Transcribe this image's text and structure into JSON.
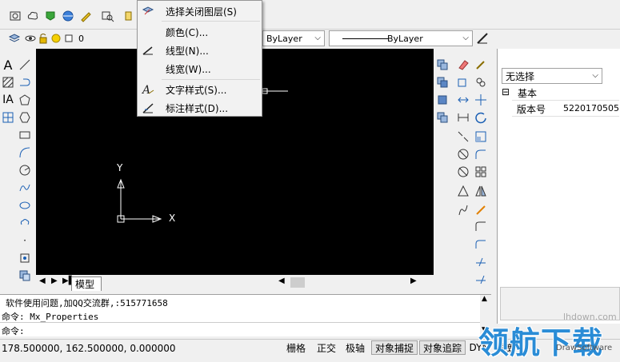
{
  "layer": {
    "current": "0"
  },
  "linetype": {
    "value": "ByLayer"
  },
  "lineweight": {
    "value": "ByLayer"
  },
  "context_menu": {
    "items": [
      {
        "label": "选择关闭图层(S)",
        "icon": "layer-off-icon"
      },
      {
        "label": "颜色(C)...",
        "icon": ""
      },
      {
        "label": "线型(N)...",
        "icon": "linetype-icon"
      },
      {
        "label": "线宽(W)...",
        "icon": ""
      },
      {
        "label": "文字样式(S)...",
        "icon": "text-style-icon"
      },
      {
        "label": "标注样式(D)...",
        "icon": "dim-style-icon"
      }
    ]
  },
  "ucs": {
    "x_label": "X",
    "y_label": "Y"
  },
  "tabs": {
    "model": "模型"
  },
  "properties": {
    "selection": "无选择",
    "group_toggle": "⊟",
    "group_name": "基本",
    "rows": [
      {
        "name": "版本号",
        "value": "5220170505"
      }
    ]
  },
  "command": {
    "lines": [
      "软件使用问题,加QQ交流群,:515771658",
      "命令: Mx_Properties"
    ],
    "prompt": "命令:"
  },
  "status": {
    "coords": "178.500000, 162.500000, 0.000000",
    "buttons": [
      "栅格",
      "正交",
      "极轴",
      "对象捕捉",
      "对象追踪",
      "DYN",
      "线宽"
    ]
  },
  "watermark": {
    "text": "领航下载",
    "site": "lhdown.com",
    "corner": "DrawSoftware"
  },
  "colors": {
    "canvas": "#000000",
    "accent_blue": "#1a5fb4",
    "toolbar": "#f0f0f0"
  }
}
